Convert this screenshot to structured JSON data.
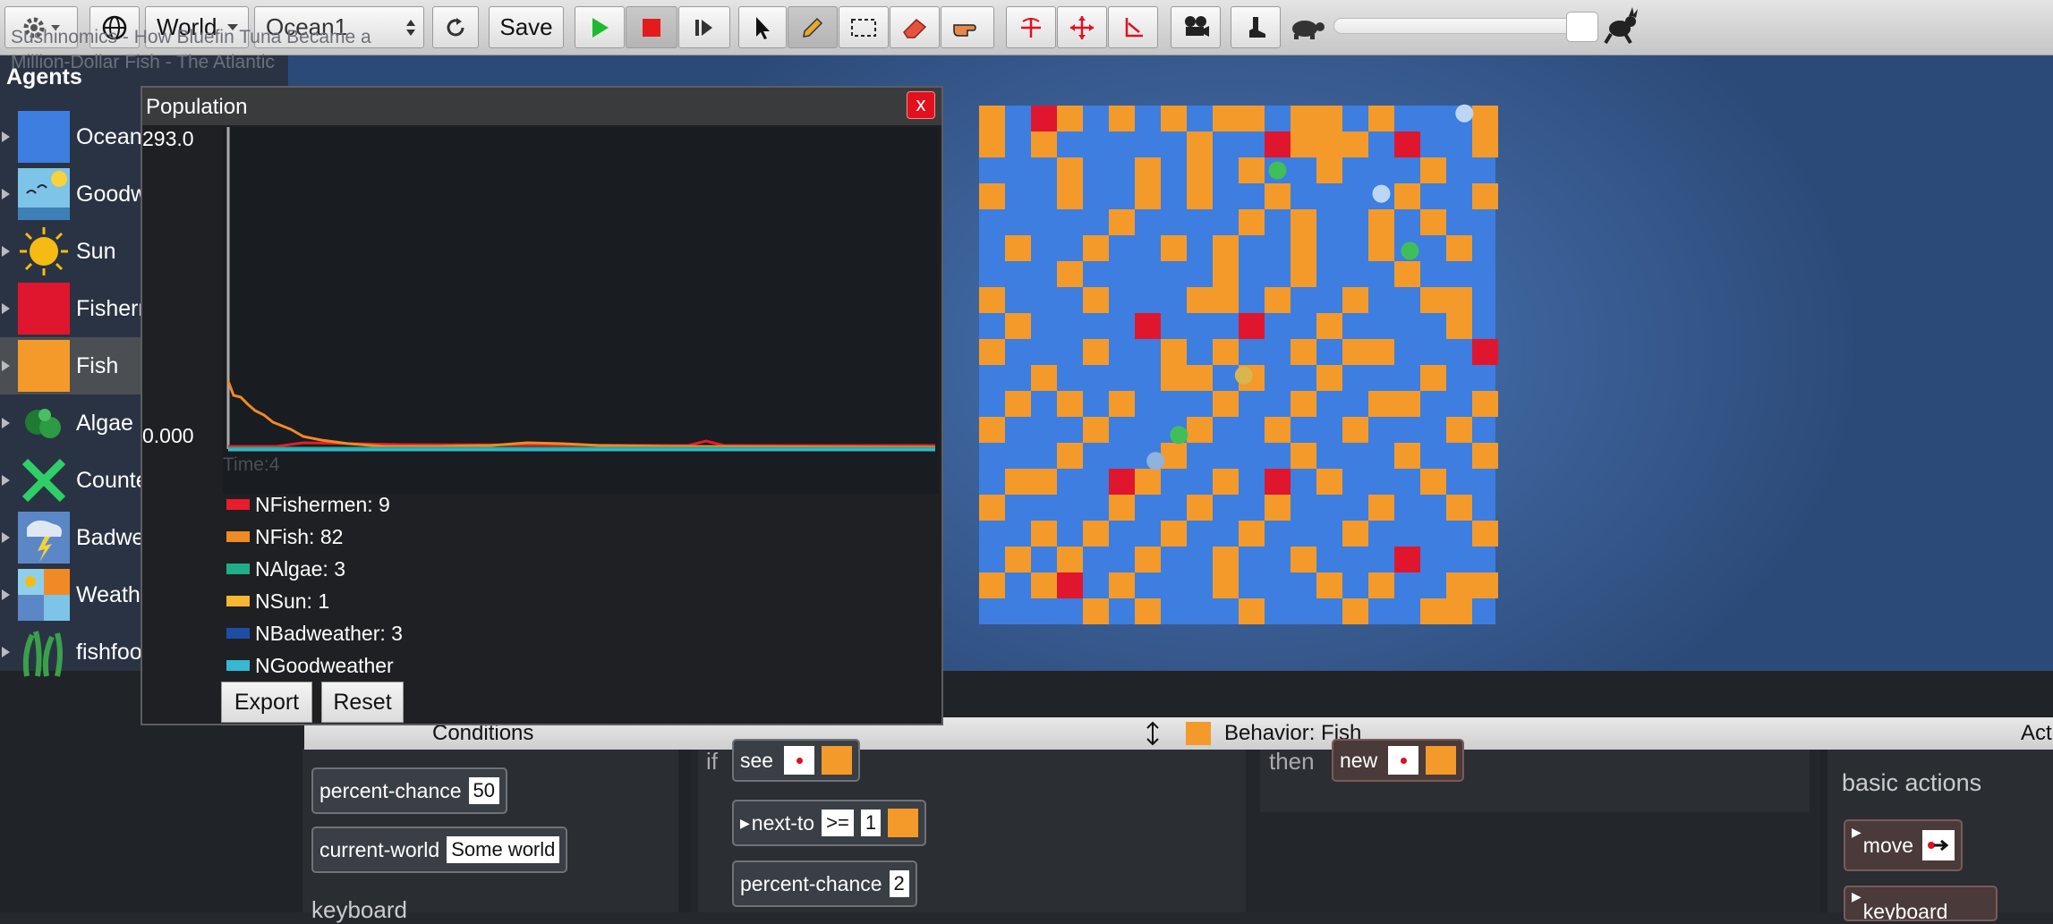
{
  "toolbar": {
    "world_select": "World",
    "world_name": "Ocean1",
    "save_label": "Save"
  },
  "ghost_text": "Sushinomics - How Bluefin Tuna Became a Million-Dollar Fish - The Atlantic",
  "agents": {
    "title": "Agents",
    "items": [
      {
        "label": "Ocean"
      },
      {
        "label": "Goodweather"
      },
      {
        "label": "Sun"
      },
      {
        "label": "Fishermen"
      },
      {
        "label": "Fish"
      },
      {
        "label": "Algae"
      },
      {
        "label": "Counter"
      },
      {
        "label": "Badweather"
      },
      {
        "label": "Weather"
      },
      {
        "label": "fishfood"
      }
    ]
  },
  "population": {
    "title": "Population",
    "close_label": "x",
    "y_max_label": "293.0",
    "y_min_label": "0.000",
    "time_label": "Time:4",
    "export_label": "Export",
    "reset_label": "Reset",
    "legend": [
      {
        "label": "NFishermen: 9",
        "color": "#e81c2c"
      },
      {
        "label": "NFish: 82",
        "color": "#f08a24"
      },
      {
        "label": "NAlgae: 3",
        "color": "#1fae88"
      },
      {
        "label": "NSun: 1",
        "color": "#f7b733"
      },
      {
        "label": "NBadweather: 3",
        "color": "#1e4ea3"
      },
      {
        "label": "NGoodweather",
        "color": "#36b7d4"
      }
    ]
  },
  "behavior": {
    "conditions_label": "Conditions",
    "title": "Behavior: Fish",
    "actions_label": "Act",
    "if_label": "if",
    "then_label": "then",
    "see_label": "see",
    "next_to_label": "next-to",
    "next_to_op": ">=",
    "next_to_count": "1",
    "pc_label": "percent-chance",
    "pc_value": "2",
    "new_label": "new",
    "left_pc_label": "percent-chance",
    "left_pc_value": "50",
    "current_world_label": "current-world",
    "current_world_value": "Some world",
    "keyboard_label": "keyboard",
    "basic_actions_label": "basic actions",
    "move_label": "move",
    "second_action_label": "keyboard"
  },
  "colors": {
    "ocean": "#3d7ee0",
    "fish": "#f39a2a",
    "fishermen": "#e0162e"
  }
}
